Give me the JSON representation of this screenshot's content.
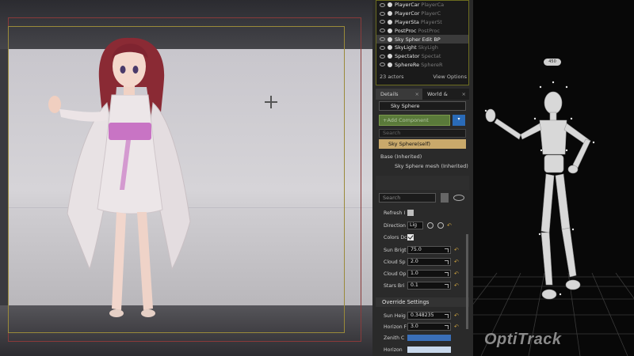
{
  "outliner": {
    "rows": [
      {
        "name": "PlayerCar",
        "type": "PlayerCa"
      },
      {
        "name": "PlayerCor",
        "type": "PlayerC"
      },
      {
        "name": "PlayerSta",
        "type": "PlayerSt"
      },
      {
        "name": "PostProc",
        "type": "PostProc"
      },
      {
        "name": "Sky Spher Edit BP",
        "type": ""
      },
      {
        "name": "SkyLight",
        "type": "SkyLigh"
      },
      {
        "name": "Spectator",
        "type": "Spectat"
      },
      {
        "name": "SphereRe",
        "type": "SphereR"
      }
    ],
    "actor_count": "23 actors",
    "view_options": "View Options"
  },
  "details": {
    "tab_details": "Details",
    "tab_world": "World &",
    "close_glyph": "×",
    "name_value": "Sky Sphere",
    "add_component_label": "+Add Component",
    "blue_button_glyph": "▾",
    "search_placeholder": "Search",
    "self_label": "Sky Sphere(self)",
    "base_label": "Base (Inherited)",
    "mesh_label": "Sky Sphere mesh (Inherited)",
    "search2_placeholder": "Search",
    "refresh_label": "Refresh I",
    "direction_label": "Direction",
    "direction_value": "Lig",
    "colors_label": "Colors Dc",
    "sun_bright_label": "Sun Brigt",
    "sun_bright_value": "75.0",
    "cloud_speed_label": "Cloud Sp",
    "cloud_speed_value": "2.0",
    "cloud_opacity_label": "Cloud Op",
    "cloud_opacity_value": "1.0",
    "stars_label": "Stars Bri",
    "stars_value": "0.1",
    "override_header": "Override Settings",
    "sun_height_label": "Sun Heig",
    "sun_height_value": "0.348235",
    "horizon_falloff_label": "Horizon F",
    "horizon_falloff_value": "3.0",
    "zenith_label": "Zenith C",
    "horizon_label": "Horizon",
    "reset_glyph": "↶",
    "zenith_color": "#3a6fb8",
    "horizon_color": "#c8d8ec"
  },
  "mocap": {
    "badge": "450",
    "logo": "OptiTrack"
  }
}
